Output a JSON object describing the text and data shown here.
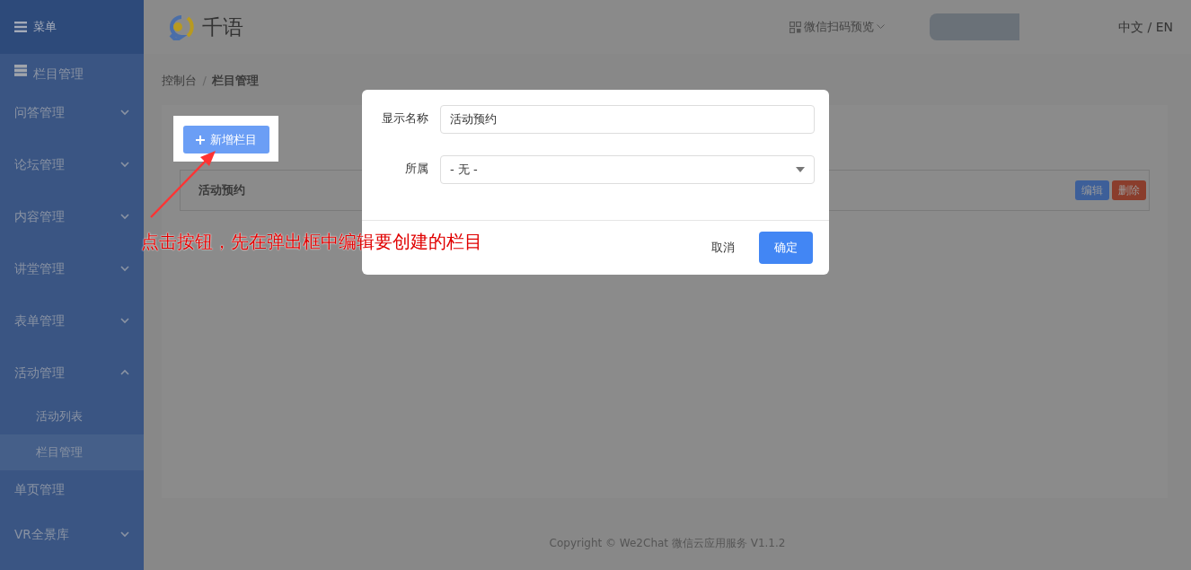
{
  "sidebar": {
    "title": "菜单",
    "items": [
      {
        "label": "栏目管理",
        "kind": "icon"
      },
      {
        "label": "问答管理",
        "kind": "group",
        "expanded": false
      },
      {
        "label": "论坛管理",
        "kind": "group",
        "expanded": false
      },
      {
        "label": "内容管理",
        "kind": "group",
        "expanded": false
      },
      {
        "label": "讲堂管理",
        "kind": "group",
        "expanded": false
      },
      {
        "label": "表单管理",
        "kind": "group",
        "expanded": false
      },
      {
        "label": "活动管理",
        "kind": "group",
        "expanded": true,
        "children": [
          {
            "label": "活动列表",
            "selected": false
          },
          {
            "label": "栏目管理",
            "selected": true
          }
        ]
      },
      {
        "label": "单页管理",
        "kind": "page"
      },
      {
        "label": "VR全景库",
        "kind": "group",
        "expanded": false
      }
    ]
  },
  "header": {
    "logo": "千语",
    "preview": "微信扫码预览",
    "language": "中文 / EN"
  },
  "breadcrumb": {
    "items": [
      "控制台",
      "栏目管理"
    ],
    "separator": "/"
  },
  "add_button": "新增栏目",
  "table": {
    "rows": [
      {
        "name": "活动预约",
        "actions": [
          {
            "label": "编辑",
            "kind": "edit"
          },
          {
            "label": "删除",
            "kind": "delete"
          }
        ]
      }
    ]
  },
  "annotation": "点击按钮，先在弹出框中编辑要创建的栏目",
  "modal": {
    "fields": [
      {
        "label": "显示名称",
        "kind": "text",
        "value": "活动预约"
      },
      {
        "label": "所属",
        "kind": "select",
        "value": "- 无 -"
      }
    ],
    "buttons": [
      {
        "label": "取消",
        "kind": "secondary"
      },
      {
        "label": "确定",
        "kind": "primary"
      }
    ]
  },
  "footer": "Copyright © We2Chat 微信云应用服务 V1.1.2"
}
